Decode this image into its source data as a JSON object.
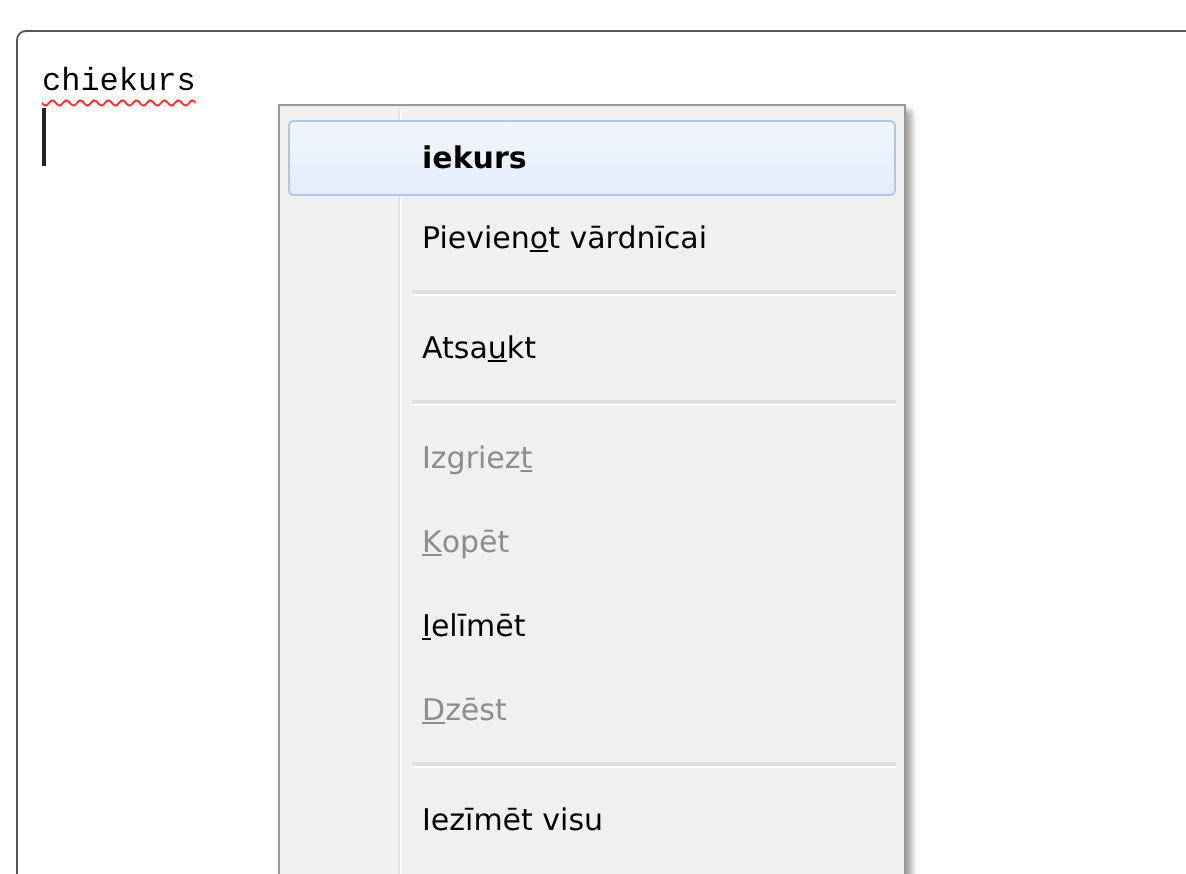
{
  "editor": {
    "text": "chiekurs",
    "misspelled": true
  },
  "menu": [
    {
      "kind": "suggestion",
      "before": "iekurs",
      "disabled": false,
      "selected": true
    },
    {
      "kind": "item",
      "before": "Pievien",
      "accel": "o",
      "after": "t vārdnīcai",
      "disabled": false,
      "selected": false
    },
    {
      "kind": "separator"
    },
    {
      "kind": "item",
      "before": "Atsa",
      "accel": "u",
      "after": "kt",
      "disabled": false,
      "selected": false
    },
    {
      "kind": "separator"
    },
    {
      "kind": "item",
      "before": "Izgriez",
      "accel": "t",
      "disabled": true,
      "selected": false
    },
    {
      "kind": "item",
      "accel": "K",
      "after": "opēt",
      "disabled": true,
      "selected": false
    },
    {
      "kind": "item",
      "accel": "I",
      "after": "elīmēt",
      "disabled": false,
      "selected": false
    },
    {
      "kind": "item",
      "accel": "D",
      "after": "zēst",
      "disabled": true,
      "selected": false
    },
    {
      "kind": "separator"
    },
    {
      "kind": "item",
      "before": "Iezīmēt visu",
      "disabled": false,
      "selected": false
    }
  ]
}
